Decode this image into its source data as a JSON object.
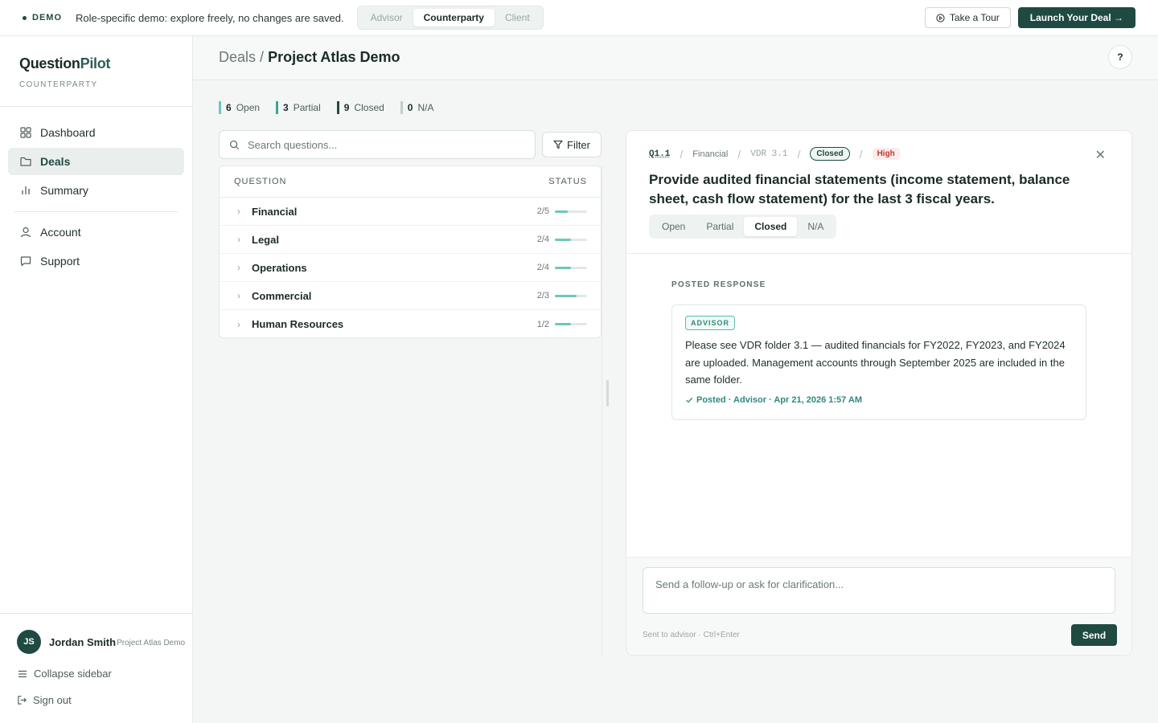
{
  "banner": {
    "demo_label": "DEMO",
    "message": "Role-specific demo: explore freely, no changes are saved.",
    "roles": [
      {
        "label": "Advisor",
        "active": false
      },
      {
        "label": "Counterparty",
        "active": true
      },
      {
        "label": "Client",
        "active": false
      }
    ],
    "tour_label": "Take a Tour",
    "launch_label": "Launch Your Deal →"
  },
  "sidebar": {
    "brand_a": "Question",
    "brand_b": "Pilot",
    "role": "COUNTERPARTY",
    "items": [
      {
        "label": "Dashboard",
        "icon": "grid-icon",
        "active": false
      },
      {
        "label": "Deals",
        "icon": "folder-icon",
        "active": true
      },
      {
        "label": "Summary",
        "icon": "bar-chart-icon",
        "active": false
      },
      {
        "label": "Account",
        "icon": "user-icon",
        "active": false
      },
      {
        "label": "Support",
        "icon": "chat-icon",
        "active": false
      }
    ],
    "user": {
      "initials": "JS",
      "name": "Jordan Smith",
      "project": "Project Atlas Demo"
    },
    "collapse_label": "Collapse sidebar",
    "signout_label": "Sign out"
  },
  "header": {
    "crumb_root": "Deals",
    "crumb_sep": "/",
    "crumb_current": "Project Atlas Demo",
    "help": "?"
  },
  "stats": [
    {
      "count": "6",
      "label": "Open",
      "color": "#6cc7bb"
    },
    {
      "count": "3",
      "label": "Partial",
      "color": "#3aa596"
    },
    {
      "count": "9",
      "label": "Closed",
      "color": "#1f4a42"
    },
    {
      "count": "0",
      "label": "N/A",
      "color": "#c5cecb"
    }
  ],
  "search": {
    "placeholder": "Search questions..."
  },
  "filter_label": "Filter",
  "table": {
    "col_question": "QUESTION",
    "col_status": "STATUS",
    "rows": [
      {
        "category": "Financial",
        "count": "2/5",
        "progress": 0.4
      },
      {
        "category": "Legal",
        "count": "2/4",
        "progress": 0.5
      },
      {
        "category": "Operations",
        "count": "2/4",
        "progress": 0.5
      },
      {
        "category": "Commercial",
        "count": "2/3",
        "progress": 0.67
      },
      {
        "category": "Human Resources",
        "count": "1/2",
        "progress": 0.5
      }
    ]
  },
  "detail": {
    "qid": "Q1.1",
    "category": "Financial",
    "vdr": "VDR 3.1",
    "status_pill": "Closed",
    "priority": "High",
    "title": "Provide audited financial statements (income statement, balance sheet, cash flow statement) for the last 3 fiscal years.",
    "status_tabs": [
      {
        "label": "Open",
        "active": false
      },
      {
        "label": "Partial",
        "active": false
      },
      {
        "label": "Closed",
        "active": true
      },
      {
        "label": "N/A",
        "active": false
      }
    ],
    "posted_label": "POSTED RESPONSE",
    "response": {
      "role": "ADVISOR",
      "text": "Please see VDR folder 3.1 — audited financials for FY2022, FY2023, and FY2024 are uploaded. Management accounts through September 2025 are included in the same folder.",
      "posted_by": "Posted · Advisor · Apr 21, 2026 1:57 AM"
    },
    "composer_placeholder": "Send a follow-up or ask for clarification...",
    "hint": "Sent to advisor · Ctrl+Enter",
    "send_label": "Send"
  }
}
